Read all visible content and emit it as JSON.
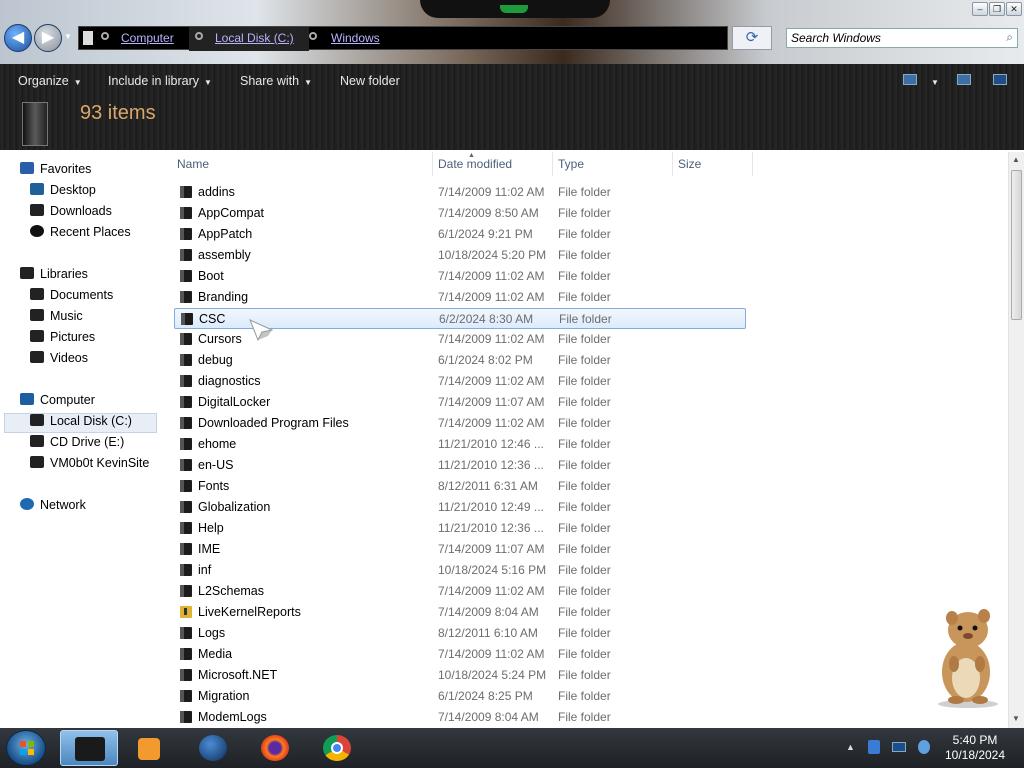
{
  "window": {
    "controls": {
      "minimize": "‒",
      "maximize": "❐",
      "close": "✕"
    }
  },
  "address_bar": {
    "breadcrumbs": [
      "Computer",
      "Local Disk (C:)",
      "Windows"
    ]
  },
  "search": {
    "placeholder": "Search Windows"
  },
  "toolbar": {
    "organize": "Organize",
    "include_in_library": "Include in library",
    "share_with": "Share with",
    "new_folder": "New folder"
  },
  "header": {
    "item_count": "93 items"
  },
  "nav": {
    "favorites": {
      "label": "Favorites",
      "items": [
        "Desktop",
        "Downloads",
        "Recent Places"
      ]
    },
    "libraries": {
      "label": "Libraries",
      "items": [
        "Documents",
        "Music",
        "Pictures",
        "Videos"
      ]
    },
    "computer": {
      "label": "Computer",
      "items": [
        "Local Disk (C:)",
        "CD Drive (E:)",
        "VM0b0t KevinSite"
      ]
    },
    "network": {
      "label": "Network"
    }
  },
  "columns": {
    "name": "Name",
    "date": "Date modified",
    "type": "Type",
    "size": "Size"
  },
  "files": [
    {
      "name": "addins",
      "date": "7/14/2009 11:02 AM",
      "type": "File folder"
    },
    {
      "name": "AppCompat",
      "date": "7/14/2009 8:50 AM",
      "type": "File folder"
    },
    {
      "name": "AppPatch",
      "date": "6/1/2024 9:21 PM",
      "type": "File folder"
    },
    {
      "name": "assembly",
      "date": "10/18/2024 5:20 PM",
      "type": "File folder"
    },
    {
      "name": "Boot",
      "date": "7/14/2009 11:02 AM",
      "type": "File folder"
    },
    {
      "name": "Branding",
      "date": "7/14/2009 11:02 AM",
      "type": "File folder"
    },
    {
      "name": "CSC",
      "date": "6/2/2024 8:30 AM",
      "type": "File folder"
    },
    {
      "name": "Cursors",
      "date": "7/14/2009 11:02 AM",
      "type": "File folder"
    },
    {
      "name": "debug",
      "date": "6/1/2024 8:02 PM",
      "type": "File folder"
    },
    {
      "name": "diagnostics",
      "date": "7/14/2009 11:02 AM",
      "type": "File folder"
    },
    {
      "name": "DigitalLocker",
      "date": "7/14/2009 11:07 AM",
      "type": "File folder"
    },
    {
      "name": "Downloaded Program Files",
      "date": "7/14/2009 11:02 AM",
      "type": "File folder"
    },
    {
      "name": "ehome",
      "date": "11/21/2010 12:46 ...",
      "type": "File folder"
    },
    {
      "name": "en-US",
      "date": "11/21/2010 12:36 ...",
      "type": "File folder"
    },
    {
      "name": "Fonts",
      "date": "8/12/2011 6:31 AM",
      "type": "File folder"
    },
    {
      "name": "Globalization",
      "date": "11/21/2010 12:49 ...",
      "type": "File folder"
    },
    {
      "name": "Help",
      "date": "11/21/2010 12:36 ...",
      "type": "File folder"
    },
    {
      "name": "IME",
      "date": "7/14/2009 11:07 AM",
      "type": "File folder"
    },
    {
      "name": "inf",
      "date": "10/18/2024 5:16 PM",
      "type": "File folder"
    },
    {
      "name": "L2Schemas",
      "date": "7/14/2009 11:02 AM",
      "type": "File folder"
    },
    {
      "name": "LiveKernelReports",
      "date": "7/14/2009 8:04 AM",
      "type": "File folder"
    },
    {
      "name": "Logs",
      "date": "8/12/2011 6:10 AM",
      "type": "File folder"
    },
    {
      "name": "Media",
      "date": "7/14/2009 11:02 AM",
      "type": "File folder"
    },
    {
      "name": "Microsoft.NET",
      "date": "10/18/2024 5:24 PM",
      "type": "File folder"
    },
    {
      "name": "Migration",
      "date": "6/1/2024 8:25 PM",
      "type": "File folder"
    },
    {
      "name": "ModemLogs",
      "date": "7/14/2009 8:04 AM",
      "type": "File folder"
    }
  ],
  "selected_file": "CSC",
  "taskbar": {
    "apps": [
      "start-orb",
      "explorer",
      "media-player",
      "network-globe",
      "firefox",
      "chrome"
    ]
  },
  "clock": {
    "time": "5:40 PM",
    "date": "10/18/2024"
  },
  "colors": {
    "accent": "#d9a86a",
    "selection": "#dcebfc",
    "link": "#b9b3ff"
  }
}
